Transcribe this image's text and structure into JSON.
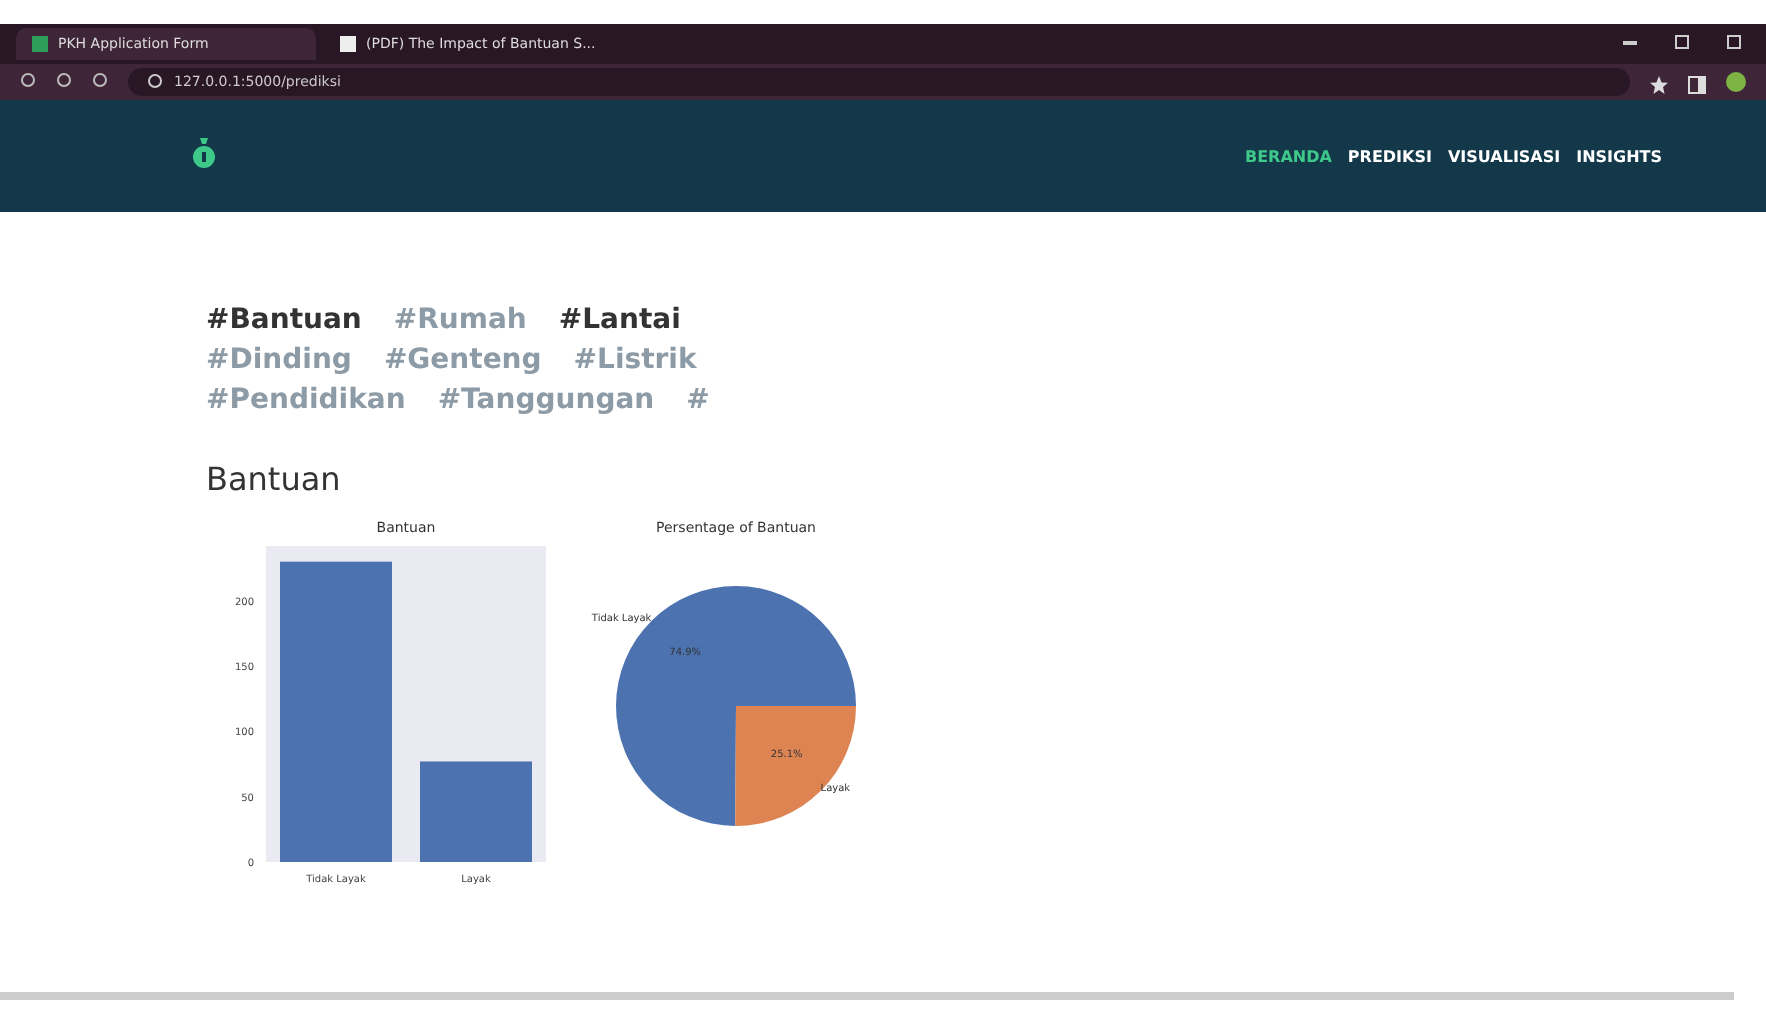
{
  "browser": {
    "tabs": [
      {
        "label": "PKH Application Form",
        "selected": true
      },
      {
        "label": "(PDF) The Impact of Bantuan S...",
        "selected": false
      }
    ],
    "url": "127.0.0.1:5000/prediksi"
  },
  "navbar": {
    "items": [
      {
        "label": "BERANDA",
        "selected": true
      },
      {
        "label": "PREDIKSI",
        "selected": false
      },
      {
        "label": "VISUALISASI",
        "selected": false
      },
      {
        "label": "INSIGHTS",
        "selected": false
      }
    ]
  },
  "tags": [
    {
      "label": "#Bantuan",
      "active": true
    },
    {
      "label": "#Rumah",
      "active": false
    },
    {
      "label": "#Lantai",
      "active": true
    },
    {
      "label": "#Dinding",
      "active": false
    },
    {
      "label": "#Genteng",
      "active": false
    },
    {
      "label": "#Listrik",
      "active": false
    },
    {
      "label": "#Pendidikan",
      "active": false
    },
    {
      "label": "#Tanggungan",
      "active": false
    },
    {
      "label": "#",
      "active": false
    }
  ],
  "section_title": "Bantuan",
  "bar_chart": {
    "chart_data": {
      "type": "bar",
      "title": "Bantuan",
      "categories": [
        "Tidak Layak",
        "Layak"
      ],
      "values": [
        230,
        77
      ],
      "ylim": [
        0,
        242
      ],
      "yticks": [
        0,
        50,
        100,
        150,
        200
      ]
    }
  },
  "pie_chart": {
    "chart_data": {
      "type": "pie",
      "title": "Persentage of Bantuan",
      "categories": [
        "Tidak Layak",
        "Layak"
      ],
      "values": [
        74.9,
        25.1
      ],
      "value_labels": [
        "74.9%",
        "25.1%"
      ]
    }
  }
}
